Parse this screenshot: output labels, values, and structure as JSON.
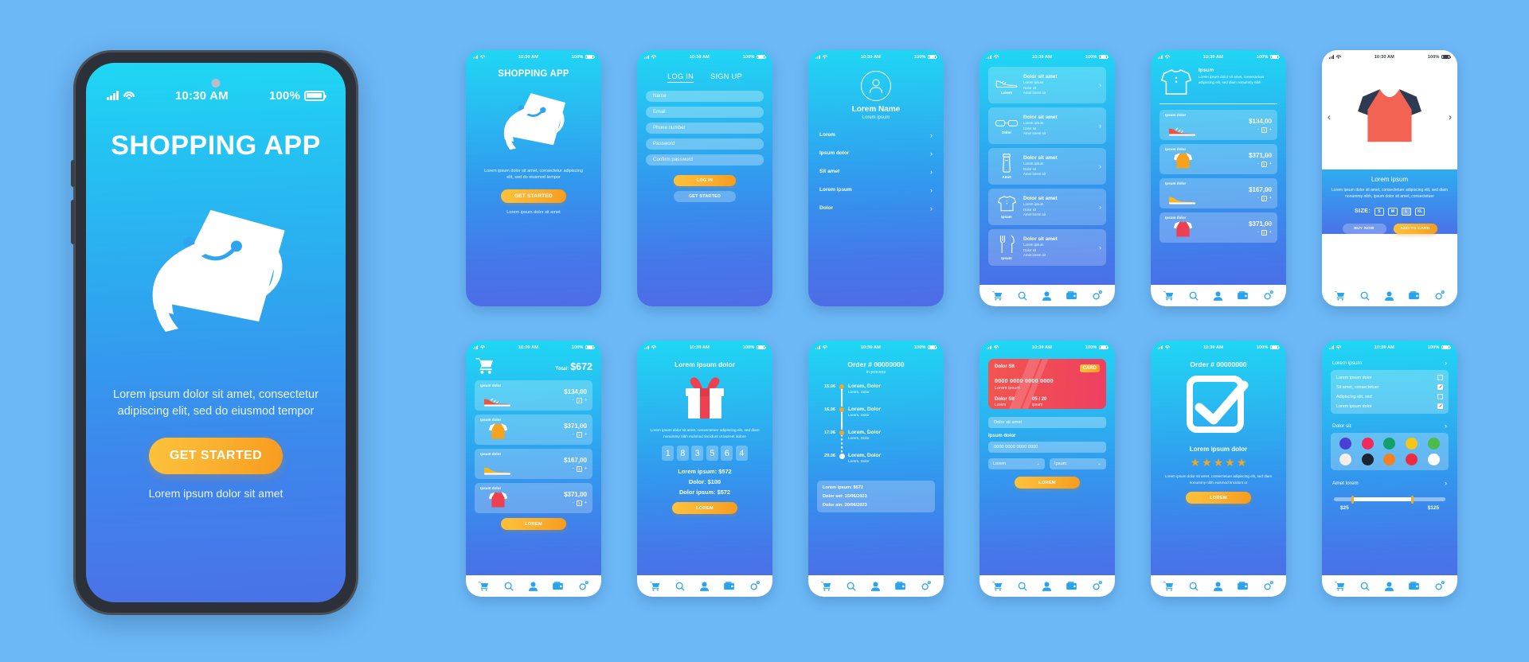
{
  "status_bar": {
    "time": "10:30 AM",
    "battery": "100%"
  },
  "main_phone": {
    "title": "SHOPPING APP",
    "subtitle": "Lorem ipsum dolor sit amet, consectetur adipiscing elit, sed do eiusmod tempor",
    "cta": "GET STARTED",
    "footer": "Lorem ipsum dolor sit amet"
  },
  "screens": {
    "splash": {
      "title": "SHOPPING APP",
      "subtitle": "Lorem ipsum dolor sit amet, consectetur adipiscing elit, sed do eiusmod tempor",
      "cta": "GET STARTED",
      "footer": "Lorem ipsum dolor sit amet"
    },
    "login": {
      "tab_login": "LOG IN",
      "tab_signup": "SIGN UP",
      "fields": [
        {
          "placeholder": "Name"
        },
        {
          "placeholder": "Email"
        },
        {
          "placeholder": "Phone number"
        },
        {
          "placeholder": "Password"
        },
        {
          "placeholder": "Confirm password"
        }
      ],
      "primary_btn": "LOG IN",
      "secondary_btn": "GET STARTED"
    },
    "profile": {
      "name": "Lorem Name",
      "subtitle": "Lorem ipsum",
      "menu": [
        "Lorem",
        "Ipsum dolor",
        "Sit amet",
        "Lorem ipsum",
        "Dolor"
      ],
      "chevron": "›"
    },
    "categories": {
      "items": [
        {
          "icon_label": "Lorem",
          "title": "Dolor sit amet",
          "lines": [
            "Lorem ipsum",
            "Dolor sit",
            "Amet lorem sit"
          ],
          "icon": "shoe-icon"
        },
        {
          "icon_label": "Dolor",
          "title": "Dolor sit amet",
          "lines": [
            "Lorem ipsum",
            "Dolor sit",
            "Amet lorem sit"
          ],
          "icon": "glasses-icon"
        },
        {
          "icon_label": "Amet",
          "title": "Dolor sit amet",
          "lines": [
            "Lorem ipsum",
            "Dolor sit",
            "Amet lorem sit"
          ],
          "icon": "tube-icon"
        },
        {
          "icon_label": "Ipsum",
          "title": "Dolor sit amet",
          "lines": [
            "Lorem ipsum",
            "Dolor sit",
            "Amet lorem sit"
          ],
          "icon": "tshirt-icon"
        },
        {
          "icon_label": "Ipsum",
          "title": "Dolor sit amet",
          "lines": [
            "Lorem ipsum",
            "Dolor sit",
            "Amet lorem sit"
          ],
          "icon": "cutlery-icon"
        }
      ],
      "chevron": "›"
    },
    "product_list": {
      "header_title": "Ipsum",
      "header_desc": "Lorem ipsum dolor sit amet, consectetuer adipiscing elit, sed diam nonummy nibh",
      "rows": [
        {
          "label": "Ipsum dolor",
          "price": "$134,00",
          "qty": "1",
          "img": "red-sneaker"
        },
        {
          "label": "Ipsum dolor",
          "price": "$371,00",
          "qty": "1",
          "img": "orange-tshirt"
        },
        {
          "label": "Ipsum dolor",
          "price": "$167,00",
          "qty": "1",
          "img": "yellow-sneaker"
        },
        {
          "label": "Ipsum dolor",
          "price": "$371,00",
          "qty": "1",
          "img": "red-tshirt"
        }
      ],
      "minus": "-",
      "plus": "+"
    },
    "product_detail": {
      "prev": "‹",
      "next": "›",
      "title": "Lorem ipsum",
      "desc": "Lorem ipsum dolor sit amet, consectetuer adipiscing elit, sed diam nonummy nibh, ipsum dolor sit amet, consectetuer",
      "size_label": "SIZE:",
      "sizes": [
        "S",
        "M",
        "L",
        "XL"
      ],
      "buy_btn": "BUY NOW",
      "add_btn": "ADD TO CARD"
    },
    "cart": {
      "total_label": "Total:",
      "total_value": "$672",
      "rows": [
        {
          "label": "Ipsum dolor",
          "price": "$134,00",
          "qty": "1",
          "img": "red-sneaker"
        },
        {
          "label": "Ipsum dolor",
          "price": "$371,00",
          "qty": "1",
          "img": "orange-tshirt"
        },
        {
          "label": "Ipsum dolor",
          "price": "$167,00",
          "qty": "1",
          "img": "yellow-sneaker"
        },
        {
          "label": "Ipsum dolor",
          "price": "$371,00",
          "qty": "1",
          "img": "red-tshirt"
        }
      ],
      "minus": "-",
      "plus": "+",
      "cta": "LOREM"
    },
    "gift": {
      "title": "Lorem ipsum dolor",
      "desc": "Lorem ipsum dolor sit amet, consectetuer adipiscing elit, sed diam nonummy nibh euismod tincidunt ut laoreet dolore",
      "pins": [
        "1",
        "8",
        "3",
        "5",
        "6",
        "4"
      ],
      "lines": [
        "Lorem ipsum: $572",
        "Dolor: $100",
        "Dolor ipsum: $572"
      ],
      "cta": "LOREM"
    },
    "tracking": {
      "title": "Order # 00000000",
      "subtitle": "in process",
      "steps": [
        {
          "date": "15.06",
          "title": "Lorem, Dolor",
          "sub": "Lorem, Dolor"
        },
        {
          "date": "16.06",
          "title": "Lorem, Dolor",
          "sub": "Lorem, Dolor"
        },
        {
          "date": "17.06",
          "title": "Lorem, Dolor",
          "sub": "Lorem, Dolor"
        },
        {
          "date": "20.06",
          "title": "Lorem, Dolor",
          "sub": "Lorem, Dolor"
        }
      ],
      "summary": [
        "Lorem ipsum: $572",
        "Dolor set: 15/06/2023",
        "Dolor sin: 20/06/2023"
      ]
    },
    "payment": {
      "card_name": "Dolor Sit",
      "card_badge": "CARD",
      "card_number": "0000 0000 0000 0000",
      "card_holder_sub": "Lorem ipsum",
      "card_bottom_left_k": "Dolor Sit",
      "card_bottom_left_v": "Lorem",
      "card_bottom_right_k": "05 / 20",
      "card_bottom_right_v": "ipsum",
      "field_name": "Dolor sit amet",
      "label_number": "Ipsum dolor",
      "field_number": "0000 0000 0000 0000",
      "select_left": "Lorem",
      "select_right": "Ipsum",
      "chevron": "⌄",
      "cta": "LOREM"
    },
    "success": {
      "title": "Order # 00000000",
      "heading": "Lorem ipsum dolor",
      "stars": 5,
      "desc": "Lorem ipsum dolor sit amet, consectetuer adipiscing elit, sed diam nonummy nibh euismod tincidunt ut",
      "cta": "LOREM"
    },
    "filters": {
      "section1": "Lorem ipsum",
      "checks": [
        {
          "label": "Lorem ipsum dolor",
          "checked": false
        },
        {
          "label": "Sit amet, consectetuer",
          "checked": true
        },
        {
          "label": "Adipiscing elit, sed",
          "checked": false
        },
        {
          "label": "Lorem ipsum dolor",
          "checked": true
        }
      ],
      "section2": "Dolor sit",
      "colors": [
        "#4a3fd4",
        "#f2295b",
        "#12a06a",
        "#f5c518",
        "#4cbb4c",
        "#f7ede6",
        "#1c2430",
        "#f58220",
        "#ef2b3f",
        "#ffffff"
      ],
      "section3": "Amet lorem",
      "price_min": "$25",
      "price_max": "$125",
      "chevron": "›"
    }
  },
  "tabbar": {
    "items": [
      "cart-icon",
      "search-icon",
      "user-icon",
      "wallet-icon",
      "gear-icon"
    ]
  },
  "colors": {
    "page_bg": "#6cb8f7",
    "accent_orange": "#f7a81e",
    "cyan": "#1fd7f4",
    "blue": "#4a72e8"
  }
}
